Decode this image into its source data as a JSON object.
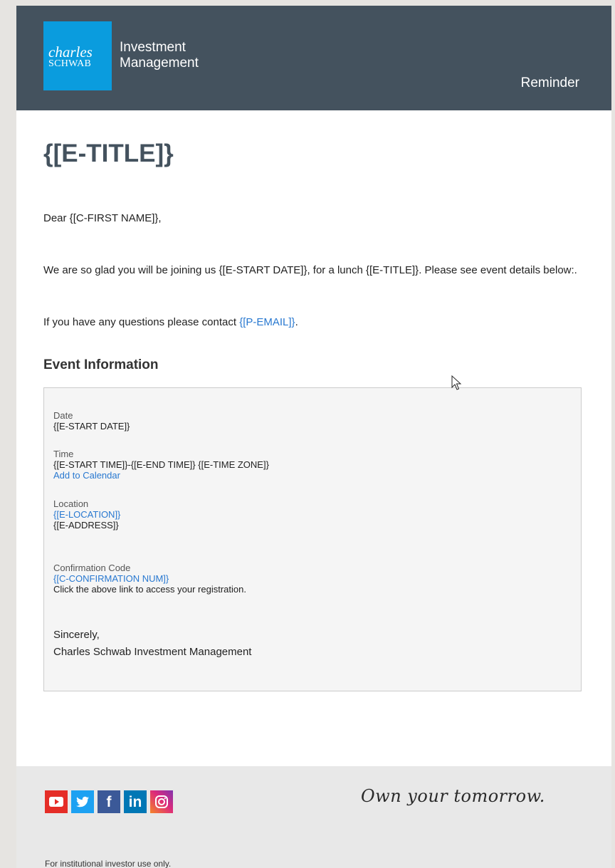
{
  "header": {
    "logo_line1": "charles",
    "logo_line2": "SCHWAB",
    "brand_line1": "Investment",
    "brand_line2": "Management",
    "badge": "Reminder"
  },
  "email": {
    "title": "{[E-TITLE]}",
    "greeting": "Dear {[C-FIRST NAME]},",
    "intro": "We are so glad you will be joining us {[E-START DATE]}, for a lunch {[E-TITLE]}. Please see event details below:.",
    "contact_prefix": "If you have any questions please contact ",
    "contact_link": "{[P-EMAIL]}",
    "contact_suffix": "."
  },
  "event": {
    "heading": "Event Information",
    "date_label": "Date",
    "date_value": "{[E-START DATE]}",
    "time_label": "Time",
    "time_value": "{[E-START TIME]}-{[E-END TIME]} {[E-TIME ZONE]}",
    "calendar_link": "Add to Calendar",
    "location_label": "Location",
    "location_link": "{[E-LOCATION]}",
    "address": "{[E-ADDRESS]}",
    "confirmation_label": "Confirmation Code",
    "confirmation_link": "{[C-CONFIRMATION NUM]}",
    "confirmation_note": "Click the above link to access your registration.",
    "signoff": "Sincerely,",
    "signature": "Charles Schwab Investment Management"
  },
  "footer": {
    "socials": [
      "youtube-icon",
      "twitter-icon",
      "facebook-icon",
      "linkedin-icon",
      "instagram-icon"
    ],
    "facebook_glyph": "f",
    "linkedin_glyph": "in",
    "tagline": "Own your tomorrow.",
    "disclaimer": "For institutional investor use only."
  },
  "colors": {
    "header_bg": "#44525e",
    "logo_bg": "#0a9cde",
    "link": "#2878d0",
    "page_bg": "#e6e4e1",
    "footer_bg": "#e8e8e8"
  }
}
